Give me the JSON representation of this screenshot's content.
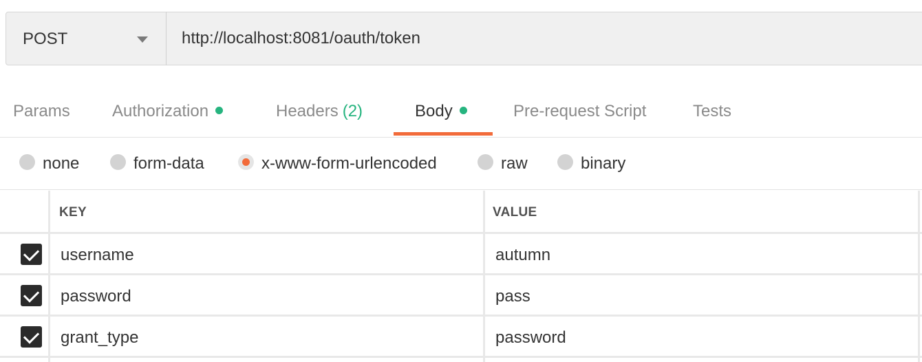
{
  "request": {
    "method": "POST",
    "url": "http://localhost:8081/oauth/token"
  },
  "tabs": [
    {
      "label": "Params"
    },
    {
      "label": "Authorization",
      "indicator": "green-dot"
    },
    {
      "label": "Headers",
      "count": "(2)"
    },
    {
      "label": "Body",
      "indicator": "green-dot",
      "active": true
    },
    {
      "label": "Pre-request Script"
    },
    {
      "label": "Tests"
    }
  ],
  "body_types": [
    {
      "label": "none"
    },
    {
      "label": "form-data"
    },
    {
      "label": "x-www-form-urlencoded",
      "selected": true
    },
    {
      "label": "raw"
    },
    {
      "label": "binary"
    }
  ],
  "table": {
    "headers": {
      "key": "KEY",
      "value": "VALUE"
    },
    "rows": [
      {
        "checked": true,
        "key": "username",
        "value": "autumn"
      },
      {
        "checked": true,
        "key": "password",
        "value": "pass"
      },
      {
        "checked": true,
        "key": "grant_type",
        "value": "password"
      }
    ]
  },
  "colors": {
    "accent": "#f26b3a",
    "indicator": "#26b47f"
  }
}
